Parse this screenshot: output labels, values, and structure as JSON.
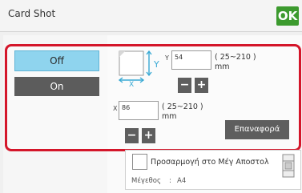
{
  "header": {
    "title": "Card Shot",
    "ok_label": "OK"
  },
  "toggle": {
    "off_label": "Off",
    "on_label": "On",
    "selected": "Off"
  },
  "y_dimension": {
    "axis": "Y",
    "value": "54",
    "range": "( 25~210 )",
    "unit": "mm"
  },
  "x_dimension": {
    "axis": "X",
    "value": "86",
    "range": "( 25~210 )",
    "unit": "mm"
  },
  "stepper": {
    "minus": "−",
    "plus": "+"
  },
  "reset_label": "Επαναφορά",
  "fit_option": {
    "label": "Προσαρμογή στο Μέγ Αποστολ"
  },
  "paper_size": {
    "label": "Μέγεθος",
    "separator": ":",
    "value": "A4"
  },
  "colors": {
    "ok_button": "#3c9a2e",
    "selected_toggle": "#8fd4ee",
    "highlight_frame": "#d4162a",
    "dark_button": "#5e5e5e",
    "axis_arrows": "#39a9d4"
  }
}
